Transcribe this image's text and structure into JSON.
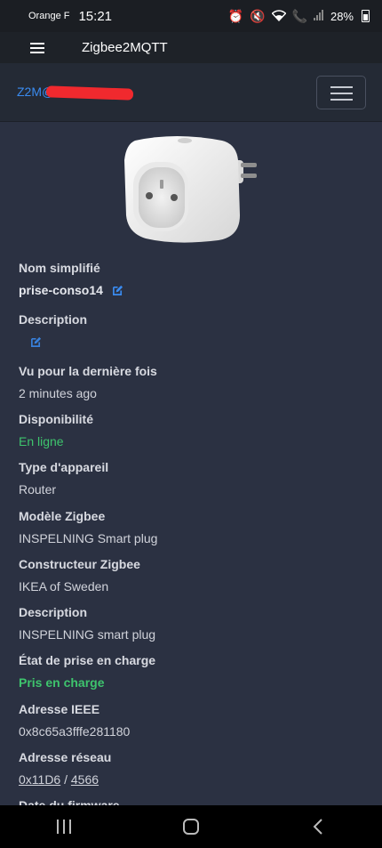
{
  "status_bar": {
    "carrier": "Orange F",
    "time": "15:21",
    "battery": "28%"
  },
  "app_bar": {
    "title": "Zigbee2MQTT"
  },
  "navbar": {
    "brand": "Z2M@"
  },
  "fields": [
    {
      "label": "Nom simplifié",
      "value": "prise-conso14"
    },
    {
      "label": "Description",
      "value": ""
    },
    {
      "label": "Vu pour la dernière fois",
      "value": "2 minutes ago"
    },
    {
      "label": "Disponibilité",
      "value": "En ligne"
    },
    {
      "label": "Type d'appareil",
      "value": "Router"
    },
    {
      "label": "Modèle Zigbee",
      "value": "INSPELNING Smart plug"
    },
    {
      "label": "Constructeur Zigbee",
      "value": "IKEA of Sweden"
    },
    {
      "label": "Description",
      "value": "INSPELNING smart plug"
    },
    {
      "label": "État de prise en charge",
      "value": "Pris en charge"
    },
    {
      "label": "Adresse IEEE",
      "value": "0x8c65a3fffe281180"
    },
    {
      "label": "Adresse réseau",
      "value_hex": "0x11D6",
      "separator": " / ",
      "value_dec": "4566"
    },
    {
      "label": "Date du firmware"
    }
  ],
  "colors": {
    "accent": "#3a8bf0",
    "success": "#3ec46d",
    "background": "#2b3142"
  },
  "icons": [
    "menu-icon",
    "edit-icon",
    "recents-icon",
    "home-icon",
    "back-icon"
  ]
}
